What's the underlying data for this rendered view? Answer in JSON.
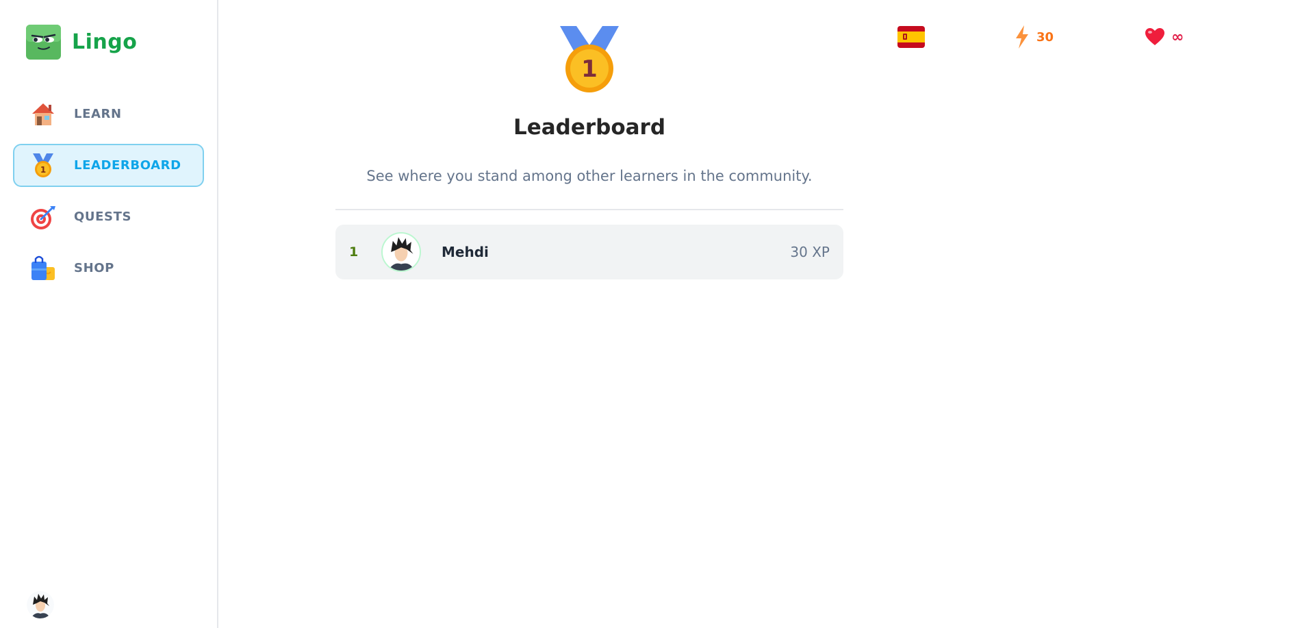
{
  "app": {
    "name": "Lingo"
  },
  "sidebar": {
    "items": [
      {
        "label": "LEARN",
        "icon": "house-icon",
        "active": false
      },
      {
        "label": "LEADERBOARD",
        "icon": "medal-icon",
        "active": true
      },
      {
        "label": "QUESTS",
        "icon": "target-icon",
        "active": false
      },
      {
        "label": "SHOP",
        "icon": "shopping-bag-icon",
        "active": false
      }
    ]
  },
  "header": {
    "course_flag": "spain-flag-icon",
    "points": "30",
    "hearts": "∞"
  },
  "leaderboard": {
    "title": "Leaderboard",
    "subtitle": "See where you stand among other learners in the community.",
    "rows": [
      {
        "rank": "1",
        "name": "Mehdi",
        "xp": "30 XP"
      }
    ]
  },
  "colors": {
    "brand": "#16a34a",
    "active_bg": "#e0f4fd",
    "active_text": "#0ea5e9",
    "streak": "#f97316",
    "heart": "#e11d48"
  }
}
